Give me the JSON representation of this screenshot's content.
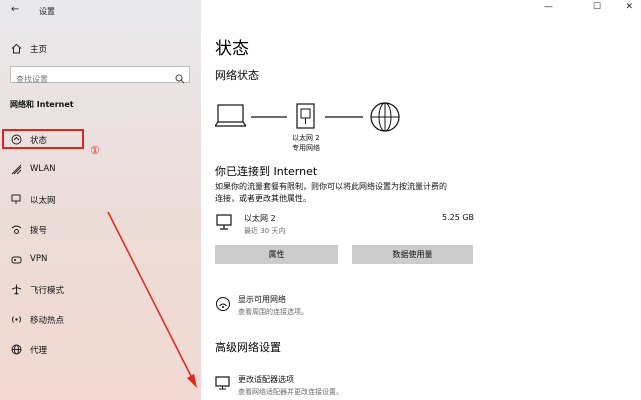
{
  "window": {
    "back_glyph": "←",
    "title": "设置",
    "controls": {
      "minimize": "—",
      "maximize": "☐",
      "close": "✕"
    }
  },
  "sidebar": {
    "home": "主页",
    "search_placeholder": "查找设置",
    "section": "网络和 Internet",
    "items": [
      {
        "icon": "status-icon",
        "label": "状态"
      },
      {
        "icon": "wifi-icon",
        "label": "WLAN"
      },
      {
        "icon": "ethernet-icon",
        "label": "以太网"
      },
      {
        "icon": "dialup-icon",
        "label": "拨号"
      },
      {
        "icon": "vpn-icon",
        "label": "VPN"
      },
      {
        "icon": "airplane-icon",
        "label": "飞行模式"
      },
      {
        "icon": "hotspot-icon",
        "label": "移动热点"
      },
      {
        "icon": "proxy-icon",
        "label": "代理"
      }
    ]
  },
  "annotation": {
    "marker": "①",
    "color": "#e0251a"
  },
  "main": {
    "title": "状态",
    "network_status": "网络状态",
    "diagram": {
      "adapter_name": "以太网 2",
      "network_type": "专用网络"
    },
    "connected_title": "你已连接到 Internet",
    "connected_desc_1": "如果你的流量套餐有限制，则你可以将此网络设置为按流量计费的",
    "connected_desc_2": "连接，或者更改其他属性。",
    "adapter": {
      "name": "以太网 2",
      "period": "最近 30 天内",
      "usage": "5.25 GB"
    },
    "buttons": {
      "properties": "属性",
      "data_usage": "数据使用量"
    },
    "show_networks": {
      "title": "显示可用网络",
      "desc": "查看周围的连接选项。"
    },
    "advanced_title": "高级网络设置",
    "change_adapter": {
      "title": "更改适配器选项",
      "desc": "查看网络适配器并更改连接设置。"
    }
  }
}
